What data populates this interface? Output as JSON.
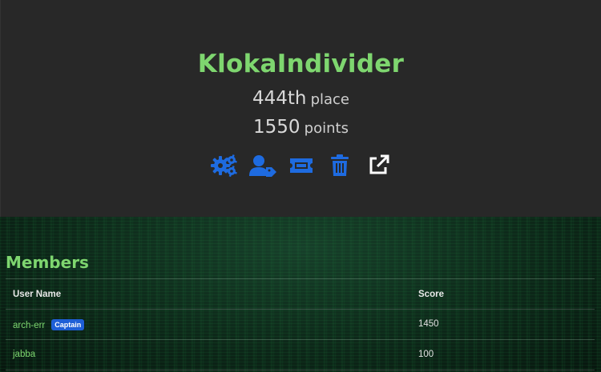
{
  "team": {
    "name": "KlokaIndivider",
    "place_number": "444th",
    "place_label": "place",
    "points_number": "1550",
    "points_label": "points"
  },
  "actions": [
    {
      "icon": "settings-gears-icon",
      "color": "#1e6be0"
    },
    {
      "icon": "user-tag-icon",
      "color": "#1e6be0"
    },
    {
      "icon": "ticket-icon",
      "color": "#1e6be0"
    },
    {
      "icon": "trash-icon",
      "color": "#1e6be0"
    },
    {
      "icon": "external-link-icon",
      "color": "#ffffff"
    }
  ],
  "members": {
    "title": "Members",
    "columns": {
      "name": "User Name",
      "score": "Score"
    },
    "rows": [
      {
        "name": "arch-err",
        "badge": "Captain",
        "score": "1450"
      },
      {
        "name": "jabba",
        "badge": "",
        "score": "100"
      }
    ]
  },
  "colors": {
    "accent_green": "#7ed66f",
    "action_blue": "#1e6be0",
    "badge_blue": "#1e5fd6"
  }
}
